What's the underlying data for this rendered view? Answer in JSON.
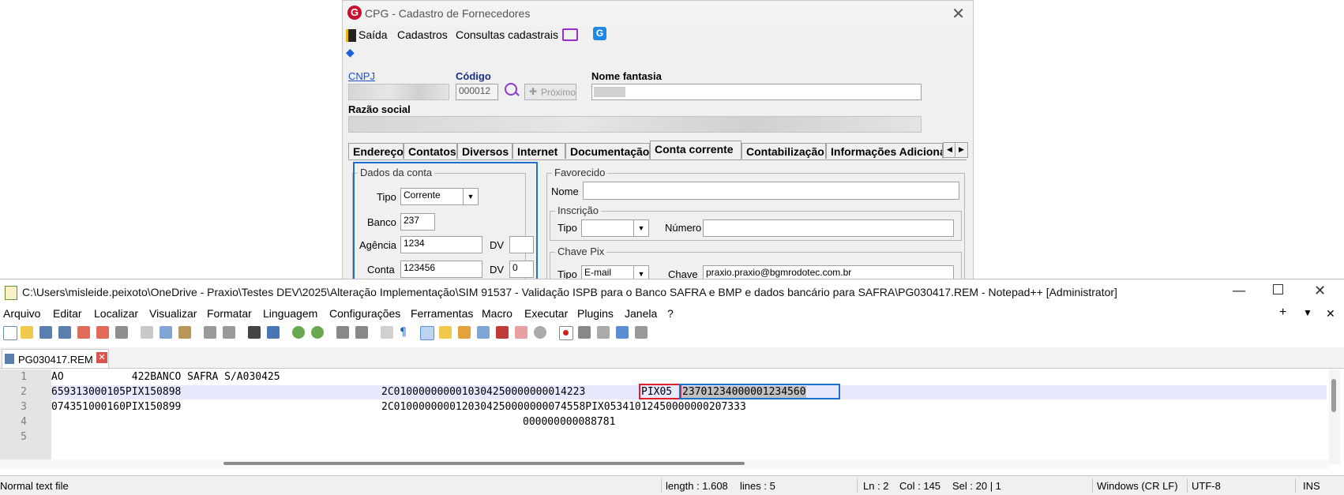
{
  "cpg": {
    "title": "CPG - Cadastro de Fornecedores",
    "menu": [
      "Saída",
      "Cadastros",
      "Consultas cadastrais"
    ],
    "cnpj_label": "CNPJ",
    "codigo_label": "Código",
    "codigo_value": "000012",
    "proximo_label": "Próximo",
    "nome_fantasia_label": "Nome fantasia",
    "razao_social_label": "Razão social",
    "tabs": [
      "Endereço",
      "Contatos",
      "Diversos",
      "Internet",
      "Documentação",
      "Conta corrente",
      "Contabilização",
      "Informações Adicionai"
    ],
    "active_tab": "Conta corrente",
    "dados_conta": {
      "title": "Dados da conta",
      "tipo_label": "Tipo",
      "tipo_value": "Corrente",
      "banco_label": "Banco",
      "banco_value": "237",
      "agencia_label": "Agência",
      "agencia_value": "1234",
      "dv_label": "DV",
      "agencia_dv": "",
      "conta_label": "Conta",
      "conta_value": "123456",
      "conta_dv": "0"
    },
    "favorecido": {
      "title": "Favorecido",
      "nome_label": "Nome",
      "nome_value": ""
    },
    "inscricao": {
      "title": "Inscrição",
      "tipo_label": "Tipo",
      "tipo_value": "",
      "numero_label": "Número",
      "numero_value": ""
    },
    "chave_pix": {
      "title": "Chave Pix",
      "tipo_label": "Tipo",
      "tipo_value": "E-mail",
      "chave_label": "Chave",
      "chave_value": "praxio.praxio@bgmrodotec.com.br"
    }
  },
  "npp": {
    "title": "C:\\Users\\misleide.peixoto\\OneDrive - Praxio\\Testes DEV\\2025\\Alteração Implementação\\SIM 91537 - Validação ISPB para o Banco SAFRA e BMP e dados bancário para SAFRA\\PG030417.REM - Notepad++ [Administrator]",
    "menu": [
      "Arquivo",
      "Editar",
      "Localizar",
      "Visualizar",
      "Formatar",
      "Linguagem",
      "Configurações",
      "Ferramentas",
      "Macro",
      "Executar",
      "Plugins",
      "Janela",
      "?"
    ],
    "file_tab": "PG030417.REM",
    "lines": [
      {
        "num": "1",
        "a": "AO           422BANCO SAFRA S/A030425",
        "b": "",
        "c": "",
        "d": ""
      },
      {
        "num": "2",
        "a": "659313000105PIX150898",
        "b": "2C0100000000010304250000000014223",
        "c": "PIX05",
        "d": "23701234000001234560"
      },
      {
        "num": "3",
        "a": "074351000160PIX150899",
        "b": "2C0100000000120304250000000074558PIX05341012450000000207333",
        "c": "",
        "d": ""
      },
      {
        "num": "4",
        "a": "",
        "b": "000000000088781",
        "c": "",
        "d": ""
      },
      {
        "num": "5",
        "a": "",
        "b": "",
        "c": "",
        "d": ""
      }
    ],
    "status": {
      "file_type": "Normal text file",
      "length": "length : 1.608",
      "lines": "lines : 5",
      "ln": "Ln : 2",
      "col": "Col : 145",
      "sel": "Sel : 20 | 1",
      "eol": "Windows (CR LF)",
      "encoding": "UTF-8",
      "mode": "INS"
    }
  }
}
